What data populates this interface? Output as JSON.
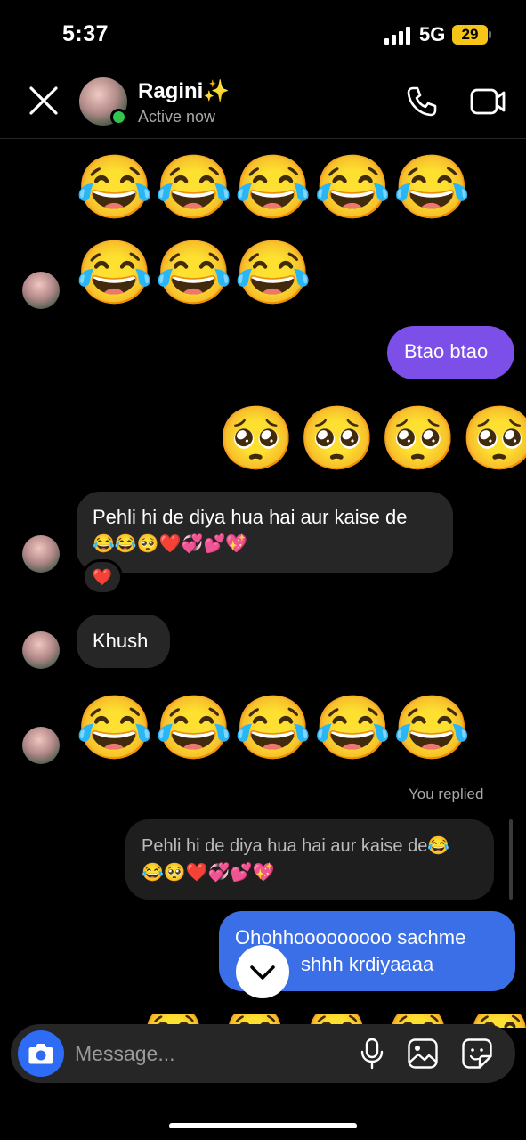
{
  "status_bar": {
    "time": "5:37",
    "network": "5G",
    "battery": "29"
  },
  "header": {
    "name": "Ragini✨",
    "status": "Active now"
  },
  "messages": {
    "m1_emojis": "😂😂😂😂😂",
    "m2_emojis": "😂😂😂",
    "m3_text": "Btao btao",
    "m4_emojis": "🥺🥺🥺🥺",
    "m5_line1": "Pehli hi de diya hua hai aur kaise de",
    "m5_line2": "😂😂🥺❤️💞💕💖",
    "m5_reaction": "❤️",
    "m6_text": "Khush",
    "m7_emojis": "😂😂😂😂😂",
    "you_replied": "You replied",
    "reply_line1": "Pehli hi de diya hua hai aur kaise de😂",
    "reply_line2": "😂🥺❤️💞💕💖",
    "m8_line1": "Ohohhooooooooo sachme",
    "m8_line2": "shhh krdiyaaaa"
  },
  "composer": {
    "placeholder": "Message..."
  },
  "icons": {
    "close": "close-icon",
    "call": "phone-icon",
    "video": "video-camera-icon",
    "camera": "camera-icon",
    "mic": "microphone-icon",
    "gallery": "image-icon",
    "sticker": "sticker-icon",
    "scroll": "chevron-down-icon"
  },
  "colors": {
    "outgoing_purple": "#7b4fe8",
    "outgoing_blue": "#3b6fe8",
    "incoming": "#262626",
    "online": "#31c552",
    "battery": "#f5c518"
  }
}
